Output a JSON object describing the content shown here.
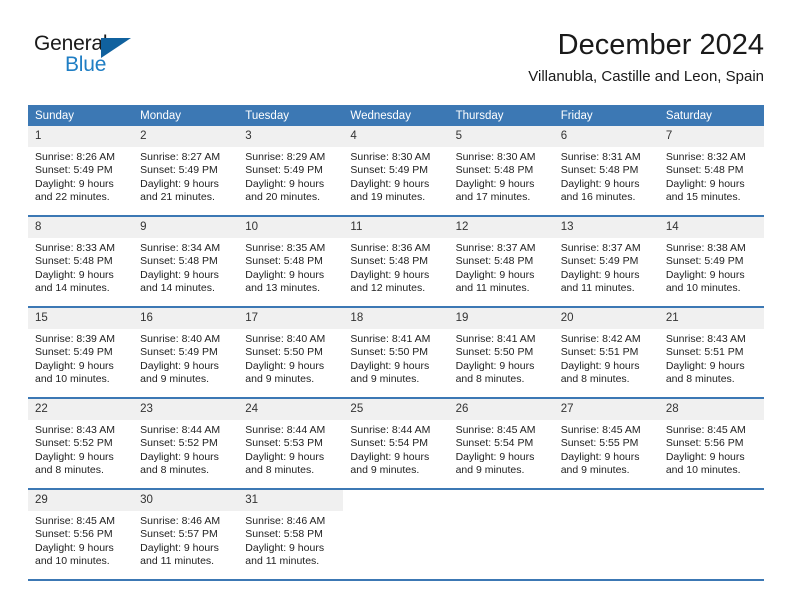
{
  "brand": {
    "word_one": "General",
    "word_two": "Blue",
    "triangle_icon": "blue-triangle-logo-mark",
    "color_dark": "#1a1a1a",
    "color_blue": "#1f7ec4",
    "color_triangle": "#10619e"
  },
  "header": {
    "title": "December 2024",
    "subtitle": "Villanubla, Castille and Leon, Spain"
  },
  "theme": {
    "header_bg": "#3c78b4",
    "header_text": "#ffffff",
    "daynum_bg": "#f0f0f0",
    "cell_bg": "#ffffff",
    "rule": "#3c78b4"
  },
  "weekday_headers": [
    "Sunday",
    "Monday",
    "Tuesday",
    "Wednesday",
    "Thursday",
    "Friday",
    "Saturday"
  ],
  "weeks": [
    [
      {
        "day": "1",
        "sunrise": "Sunrise: 8:26 AM",
        "sunset": "Sunset: 5:49 PM",
        "daylight_1": "Daylight: 9 hours",
        "daylight_2": "and 22 minutes."
      },
      {
        "day": "2",
        "sunrise": "Sunrise: 8:27 AM",
        "sunset": "Sunset: 5:49 PM",
        "daylight_1": "Daylight: 9 hours",
        "daylight_2": "and 21 minutes."
      },
      {
        "day": "3",
        "sunrise": "Sunrise: 8:29 AM",
        "sunset": "Sunset: 5:49 PM",
        "daylight_1": "Daylight: 9 hours",
        "daylight_2": "and 20 minutes."
      },
      {
        "day": "4",
        "sunrise": "Sunrise: 8:30 AM",
        "sunset": "Sunset: 5:49 PM",
        "daylight_1": "Daylight: 9 hours",
        "daylight_2": "and 19 minutes."
      },
      {
        "day": "5",
        "sunrise": "Sunrise: 8:30 AM",
        "sunset": "Sunset: 5:48 PM",
        "daylight_1": "Daylight: 9 hours",
        "daylight_2": "and 17 minutes."
      },
      {
        "day": "6",
        "sunrise": "Sunrise: 8:31 AM",
        "sunset": "Sunset: 5:48 PM",
        "daylight_1": "Daylight: 9 hours",
        "daylight_2": "and 16 minutes."
      },
      {
        "day": "7",
        "sunrise": "Sunrise: 8:32 AM",
        "sunset": "Sunset: 5:48 PM",
        "daylight_1": "Daylight: 9 hours",
        "daylight_2": "and 15 minutes."
      }
    ],
    [
      {
        "day": "8",
        "sunrise": "Sunrise: 8:33 AM",
        "sunset": "Sunset: 5:48 PM",
        "daylight_1": "Daylight: 9 hours",
        "daylight_2": "and 14 minutes."
      },
      {
        "day": "9",
        "sunrise": "Sunrise: 8:34 AM",
        "sunset": "Sunset: 5:48 PM",
        "daylight_1": "Daylight: 9 hours",
        "daylight_2": "and 14 minutes."
      },
      {
        "day": "10",
        "sunrise": "Sunrise: 8:35 AM",
        "sunset": "Sunset: 5:48 PM",
        "daylight_1": "Daylight: 9 hours",
        "daylight_2": "and 13 minutes."
      },
      {
        "day": "11",
        "sunrise": "Sunrise: 8:36 AM",
        "sunset": "Sunset: 5:48 PM",
        "daylight_1": "Daylight: 9 hours",
        "daylight_2": "and 12 minutes."
      },
      {
        "day": "12",
        "sunrise": "Sunrise: 8:37 AM",
        "sunset": "Sunset: 5:48 PM",
        "daylight_1": "Daylight: 9 hours",
        "daylight_2": "and 11 minutes."
      },
      {
        "day": "13",
        "sunrise": "Sunrise: 8:37 AM",
        "sunset": "Sunset: 5:49 PM",
        "daylight_1": "Daylight: 9 hours",
        "daylight_2": "and 11 minutes."
      },
      {
        "day": "14",
        "sunrise": "Sunrise: 8:38 AM",
        "sunset": "Sunset: 5:49 PM",
        "daylight_1": "Daylight: 9 hours",
        "daylight_2": "and 10 minutes."
      }
    ],
    [
      {
        "day": "15",
        "sunrise": "Sunrise: 8:39 AM",
        "sunset": "Sunset: 5:49 PM",
        "daylight_1": "Daylight: 9 hours",
        "daylight_2": "and 10 minutes."
      },
      {
        "day": "16",
        "sunrise": "Sunrise: 8:40 AM",
        "sunset": "Sunset: 5:49 PM",
        "daylight_1": "Daylight: 9 hours",
        "daylight_2": "and 9 minutes."
      },
      {
        "day": "17",
        "sunrise": "Sunrise: 8:40 AM",
        "sunset": "Sunset: 5:50 PM",
        "daylight_1": "Daylight: 9 hours",
        "daylight_2": "and 9 minutes."
      },
      {
        "day": "18",
        "sunrise": "Sunrise: 8:41 AM",
        "sunset": "Sunset: 5:50 PM",
        "daylight_1": "Daylight: 9 hours",
        "daylight_2": "and 9 minutes."
      },
      {
        "day": "19",
        "sunrise": "Sunrise: 8:41 AM",
        "sunset": "Sunset: 5:50 PM",
        "daylight_1": "Daylight: 9 hours",
        "daylight_2": "and 8 minutes."
      },
      {
        "day": "20",
        "sunrise": "Sunrise: 8:42 AM",
        "sunset": "Sunset: 5:51 PM",
        "daylight_1": "Daylight: 9 hours",
        "daylight_2": "and 8 minutes."
      },
      {
        "day": "21",
        "sunrise": "Sunrise: 8:43 AM",
        "sunset": "Sunset: 5:51 PM",
        "daylight_1": "Daylight: 9 hours",
        "daylight_2": "and 8 minutes."
      }
    ],
    [
      {
        "day": "22",
        "sunrise": "Sunrise: 8:43 AM",
        "sunset": "Sunset: 5:52 PM",
        "daylight_1": "Daylight: 9 hours",
        "daylight_2": "and 8 minutes."
      },
      {
        "day": "23",
        "sunrise": "Sunrise: 8:44 AM",
        "sunset": "Sunset: 5:52 PM",
        "daylight_1": "Daylight: 9 hours",
        "daylight_2": "and 8 minutes."
      },
      {
        "day": "24",
        "sunrise": "Sunrise: 8:44 AM",
        "sunset": "Sunset: 5:53 PM",
        "daylight_1": "Daylight: 9 hours",
        "daylight_2": "and 8 minutes."
      },
      {
        "day": "25",
        "sunrise": "Sunrise: 8:44 AM",
        "sunset": "Sunset: 5:54 PM",
        "daylight_1": "Daylight: 9 hours",
        "daylight_2": "and 9 minutes."
      },
      {
        "day": "26",
        "sunrise": "Sunrise: 8:45 AM",
        "sunset": "Sunset: 5:54 PM",
        "daylight_1": "Daylight: 9 hours",
        "daylight_2": "and 9 minutes."
      },
      {
        "day": "27",
        "sunrise": "Sunrise: 8:45 AM",
        "sunset": "Sunset: 5:55 PM",
        "daylight_1": "Daylight: 9 hours",
        "daylight_2": "and 9 minutes."
      },
      {
        "day": "28",
        "sunrise": "Sunrise: 8:45 AM",
        "sunset": "Sunset: 5:56 PM",
        "daylight_1": "Daylight: 9 hours",
        "daylight_2": "and 10 minutes."
      }
    ],
    [
      {
        "day": "29",
        "sunrise": "Sunrise: 8:45 AM",
        "sunset": "Sunset: 5:56 PM",
        "daylight_1": "Daylight: 9 hours",
        "daylight_2": "and 10 minutes."
      },
      {
        "day": "30",
        "sunrise": "Sunrise: 8:46 AM",
        "sunset": "Sunset: 5:57 PM",
        "daylight_1": "Daylight: 9 hours",
        "daylight_2": "and 11 minutes."
      },
      {
        "day": "31",
        "sunrise": "Sunrise: 8:46 AM",
        "sunset": "Sunset: 5:58 PM",
        "daylight_1": "Daylight: 9 hours",
        "daylight_2": "and 11 minutes."
      },
      {
        "day": "",
        "sunrise": "",
        "sunset": "",
        "daylight_1": "",
        "daylight_2": ""
      },
      {
        "day": "",
        "sunrise": "",
        "sunset": "",
        "daylight_1": "",
        "daylight_2": ""
      },
      {
        "day": "",
        "sunrise": "",
        "sunset": "",
        "daylight_1": "",
        "daylight_2": ""
      },
      {
        "day": "",
        "sunrise": "",
        "sunset": "",
        "daylight_1": "",
        "daylight_2": ""
      }
    ]
  ]
}
